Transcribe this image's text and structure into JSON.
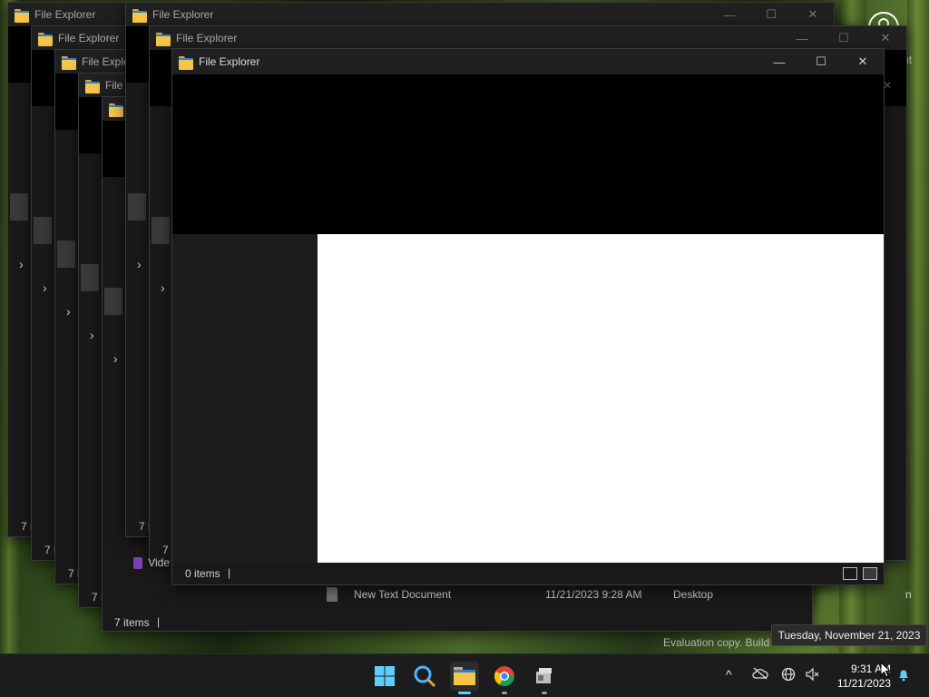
{
  "desktop": {
    "about_text": "about",
    "evaluation_text": "Evaluation copy. Build",
    "truncated_right_text": "n"
  },
  "windows": [
    {
      "title": "File Explorer",
      "status": "7 i"
    },
    {
      "title": "File Explorer",
      "status": "7 i"
    },
    {
      "title": "File Explo",
      "status": "7 i"
    },
    {
      "title": "File",
      "status": "7 i"
    },
    {
      "title": "",
      "status": "7 i"
    },
    {
      "title": "File Explorer",
      "status": "7 i"
    },
    {
      "title": "File Explorer",
      "status": "7 i"
    }
  ],
  "behind_window": {
    "partial_label": "Vide",
    "status": "7 items",
    "file_row": {
      "name": "New Text Document",
      "date": "11/21/2023 9:28 AM",
      "location": "Desktop"
    }
  },
  "main_window": {
    "title": "File Explorer",
    "status": "0 items",
    "status_separator": "|",
    "minimize": "—",
    "maximize": "☐",
    "close": "✕"
  },
  "taskbar": {
    "time": "9:31 AM",
    "date": "11/21/2023",
    "tooltip": "Tuesday, November 21, 2023",
    "icons": [
      "windows-start-icon",
      "search-icon",
      "file-explorer-icon",
      "chrome-icon",
      "app-icon"
    ],
    "accent": "#60cdff"
  },
  "chevron": "›",
  "close_glyph": "✕",
  "tray": {
    "overflow": "^"
  }
}
